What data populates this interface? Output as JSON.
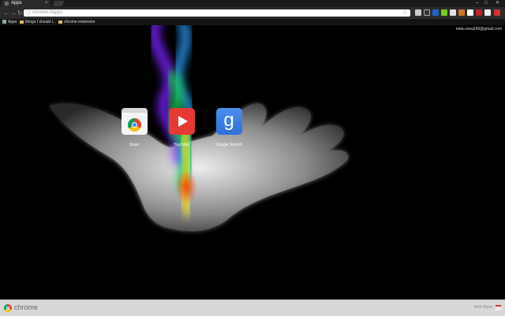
{
  "tab": {
    "title": "Apps",
    "close": "×"
  },
  "window_controls": {
    "minimize": "–",
    "maximize": "□",
    "close": "✕"
  },
  "toolbar": {
    "back": "←",
    "forward": "→",
    "reload": "↻",
    "url": "chrome://apps",
    "bookmark_star": "☆"
  },
  "bookmarks": {
    "items": [
      "Apps",
      "things I should l...",
      "chrome extension"
    ]
  },
  "user": {
    "email": "neta.ceea249@gmail.com"
  },
  "apps": [
    {
      "label": "Store",
      "icon": "chrome-web-store-icon"
    },
    {
      "label": "YouTube",
      "icon": "youtube-icon"
    },
    {
      "label": "Google Search",
      "icon": "google-search-icon"
    }
  ],
  "footer": {
    "brand": "chrome",
    "web_store": "Web Store"
  }
}
